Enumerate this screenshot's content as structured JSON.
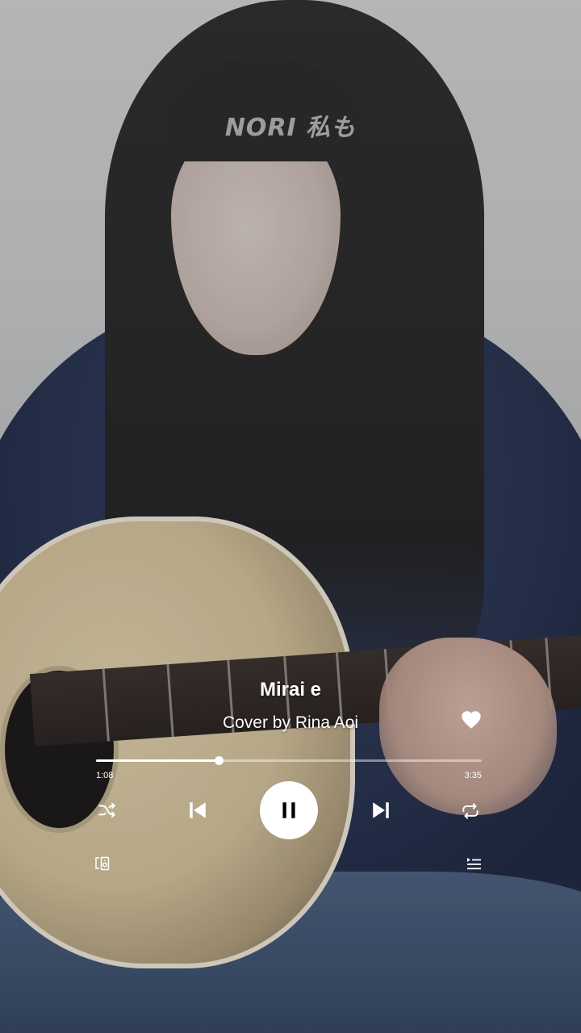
{
  "watermark": "NORI 私も",
  "player": {
    "title": "Mirai e",
    "artist": "Cover by Rina Aoi",
    "liked": true,
    "elapsed": "1:08",
    "duration": "3:35",
    "progress_fraction": 0.319,
    "state": "playing"
  },
  "icons": {
    "like": "heart-icon",
    "shuffle": "shuffle-icon",
    "previous": "skip-previous-icon",
    "play_pause": "pause-icon",
    "next": "skip-next-icon",
    "repeat": "repeat-icon",
    "devices": "devices-icon",
    "queue": "queue-icon"
  },
  "colors": {
    "controls": "#ffffff",
    "play_button_glyph": "#000000",
    "progress_remaining": "rgba(255,255,255,0.45)"
  }
}
